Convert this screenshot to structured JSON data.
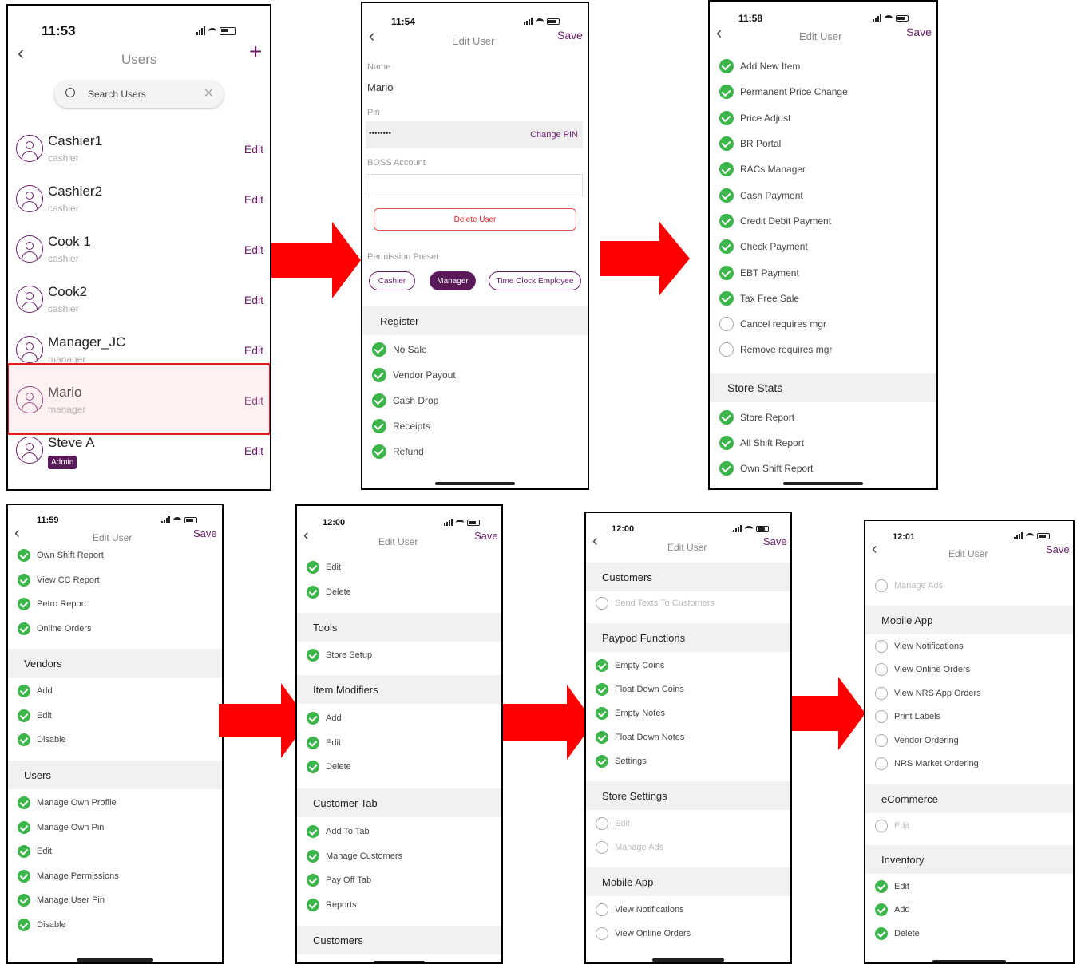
{
  "colors": {
    "accent": "#6b1d6b",
    "check": "#3cb54a",
    "arrow": "#ff0000",
    "highlight": "#e02020"
  },
  "screen1": {
    "time": "11:53",
    "title": "Users",
    "add_icon": "plus-icon",
    "search_placeholder": "Search Users",
    "users": [
      {
        "name": "Cashier1",
        "role": "cashier",
        "edit": "Edit"
      },
      {
        "name": "Cashier2",
        "role": "cashier",
        "edit": "Edit"
      },
      {
        "name": "Cook 1",
        "role": "cashier",
        "edit": "Edit"
      },
      {
        "name": "Cook2",
        "role": "cashier",
        "edit": "Edit"
      },
      {
        "name": "Manager_JC",
        "role": "manager",
        "edit": "Edit"
      },
      {
        "name": "Mario",
        "role": "manager",
        "edit": "Edit"
      },
      {
        "name": "Steve A",
        "role": "Admin",
        "edit": "Edit"
      }
    ]
  },
  "screen2": {
    "time": "11:54",
    "title": "Edit User",
    "save": "Save",
    "name_label": "Name",
    "name_value": "Mario",
    "pin_label": "Pin",
    "pin_value": "••••••••",
    "change_pin": "Change PIN",
    "boss_label": "BOSS Account",
    "delete_user": "Delete User",
    "preset_label": "Permission Preset",
    "presets": [
      "Cashier",
      "Manager",
      "Time Clock Employee"
    ],
    "section": "Register",
    "items": [
      "No Sale",
      "Vendor Payout",
      "Cash Drop",
      "Receipts",
      "Refund"
    ]
  },
  "screen3": {
    "time": "11:58",
    "title": "Edit User",
    "save": "Save",
    "items": [
      "Add New Item",
      "Permanent Price Change",
      "Price Adjust",
      "BR Portal",
      "RACs Manager",
      "Cash Payment",
      "Credit Debit Payment",
      "Check Payment",
      "EBT Payment",
      "Tax Free Sale",
      "Cancel requires mgr",
      "Remove requires mgr"
    ],
    "section": "Store Stats",
    "items2": [
      "Store Report",
      "All Shift Report",
      "Own Shift Report"
    ]
  },
  "screen4": {
    "time": "11:59",
    "title": "Edit User",
    "save": "Save",
    "items": [
      "Own Shift Report",
      "View CC Report",
      "Petro Report",
      "Online Orders"
    ],
    "section1": "Vendors",
    "items1": [
      "Add",
      "Edit",
      "Disable"
    ],
    "section2": "Users",
    "items2": [
      "Manage Own Profile",
      "Manage Own Pin",
      "Edit",
      "Manage Permissions",
      "Manage User Pin",
      "Disable"
    ]
  },
  "screen5": {
    "time": "12:00",
    "title": "Edit User",
    "save": "Save",
    "items": [
      "Edit",
      "Delete"
    ],
    "section1": "Tools",
    "items1": [
      "Store Setup"
    ],
    "section2": "Item Modifiers",
    "items2": [
      "Add",
      "Edit",
      "Delete"
    ],
    "section3": "Customer Tab",
    "items3": [
      "Add To Tab",
      "Manage Customers",
      "Pay Off Tab",
      "Reports"
    ],
    "section4": "Customers"
  },
  "screen6": {
    "time": "12:00",
    "title": "Edit User",
    "save": "Save",
    "section1": "Customers",
    "items1": [
      "Send Texts To Customers"
    ],
    "section2": "Paypod Functions",
    "items2": [
      "Empty Coins",
      "Float Down Coins",
      "Empty Notes",
      "Float Down Notes",
      "Settings"
    ],
    "section3": "Store Settings",
    "items3": [
      "Edit",
      "Manage Ads"
    ],
    "section4": "Mobile App",
    "items4": [
      "View Notifications",
      "View Online Orders"
    ]
  },
  "screen7": {
    "time": "12:01",
    "title": "Edit User",
    "save": "Save",
    "items": [
      "Manage Ads"
    ],
    "section1": "Mobile App",
    "items1": [
      "View Notifications",
      "View Online Orders",
      "View NRS App Orders",
      "Print Labels",
      "Vendor Ordering",
      "NRS Market Ordering"
    ],
    "section2": "eCommerce",
    "items2": [
      "Edit"
    ],
    "section3": "Inventory",
    "items3": [
      "Edit",
      "Add",
      "Delete"
    ]
  }
}
